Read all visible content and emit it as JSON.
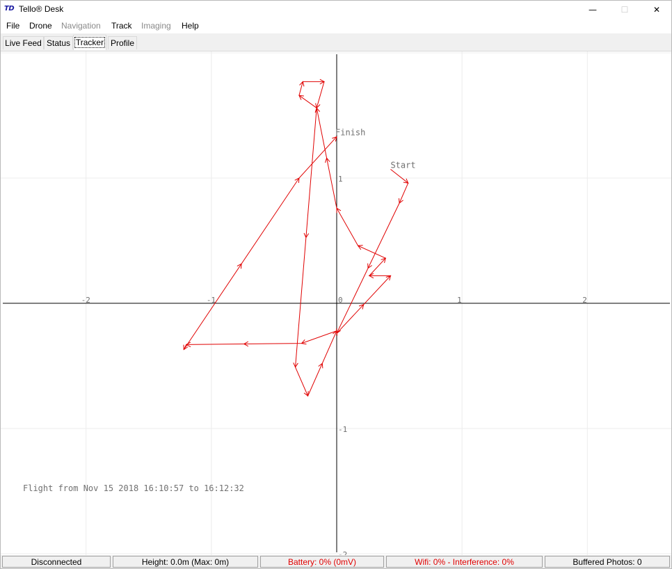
{
  "window": {
    "app_icon_text": "TD",
    "title": "Tello® Desk",
    "minimize_glyph": "—",
    "maximize_glyph": "☐",
    "close_glyph": "✕"
  },
  "menu": {
    "file": "File",
    "drone": "Drone",
    "navigation": "Navigation",
    "track": "Track",
    "imaging": "Imaging",
    "help": "Help"
  },
  "tabs": {
    "live_feed": "Live Feed",
    "status": "Status",
    "tracker": "Tracker",
    "profile": "Profile",
    "active": "tracker"
  },
  "chart_data": {
    "type": "line",
    "xlim": [
      -2.67,
      2.67
    ],
    "ylim": [
      -2.0,
      2.0
    ],
    "x_ticks": [
      -2,
      -1,
      1,
      2
    ],
    "y_ticks": [
      1,
      -1,
      -2
    ],
    "origin_label": "0",
    "grid": true,
    "series_color": "#e00000",
    "start_label": "Start",
    "finish_label": "Finish",
    "path": [
      {
        "x": 0.43,
        "y": 1.07
      },
      {
        "x": 0.57,
        "y": 0.96
      },
      {
        "x": 0.5,
        "y": 0.8
      },
      {
        "x": 0.0,
        "y": -0.24
      },
      {
        "x": 0.43,
        "y": 0.22
      },
      {
        "x": 0.26,
        "y": 0.22
      },
      {
        "x": 0.39,
        "y": 0.36
      },
      {
        "x": 0.17,
        "y": 0.46
      },
      {
        "x": 0.0,
        "y": 0.76
      },
      {
        "x": -0.16,
        "y": 1.56
      },
      {
        "x": -0.3,
        "y": 1.66
      },
      {
        "x": -0.27,
        "y": 1.77
      },
      {
        "x": -0.1,
        "y": 1.77
      },
      {
        "x": -0.16,
        "y": 1.56
      },
      {
        "x": -0.33,
        "y": -0.51
      },
      {
        "x": -0.23,
        "y": -0.74
      },
      {
        "x": 0.0,
        "y": -0.22
      },
      {
        "x": -0.28,
        "y": -0.32
      },
      {
        "x": -1.2,
        "y": -0.33
      },
      {
        "x": -1.22,
        "y": -0.37
      },
      {
        "x": -0.3,
        "y": 1.0
      },
      {
        "x": 0.0,
        "y": 1.33
      }
    ],
    "caption": "Flight from Nov 15 2018 16:10:57 to 16:12:32"
  },
  "statusbar": {
    "connection": "Disconnected",
    "height": "Height: 0.0m (Max: 0m)",
    "battery": "Battery: 0% (0mV)",
    "wifi": "Wifi: 0% - Interference: 0%",
    "buffered": "Buffered Photos: 0"
  }
}
